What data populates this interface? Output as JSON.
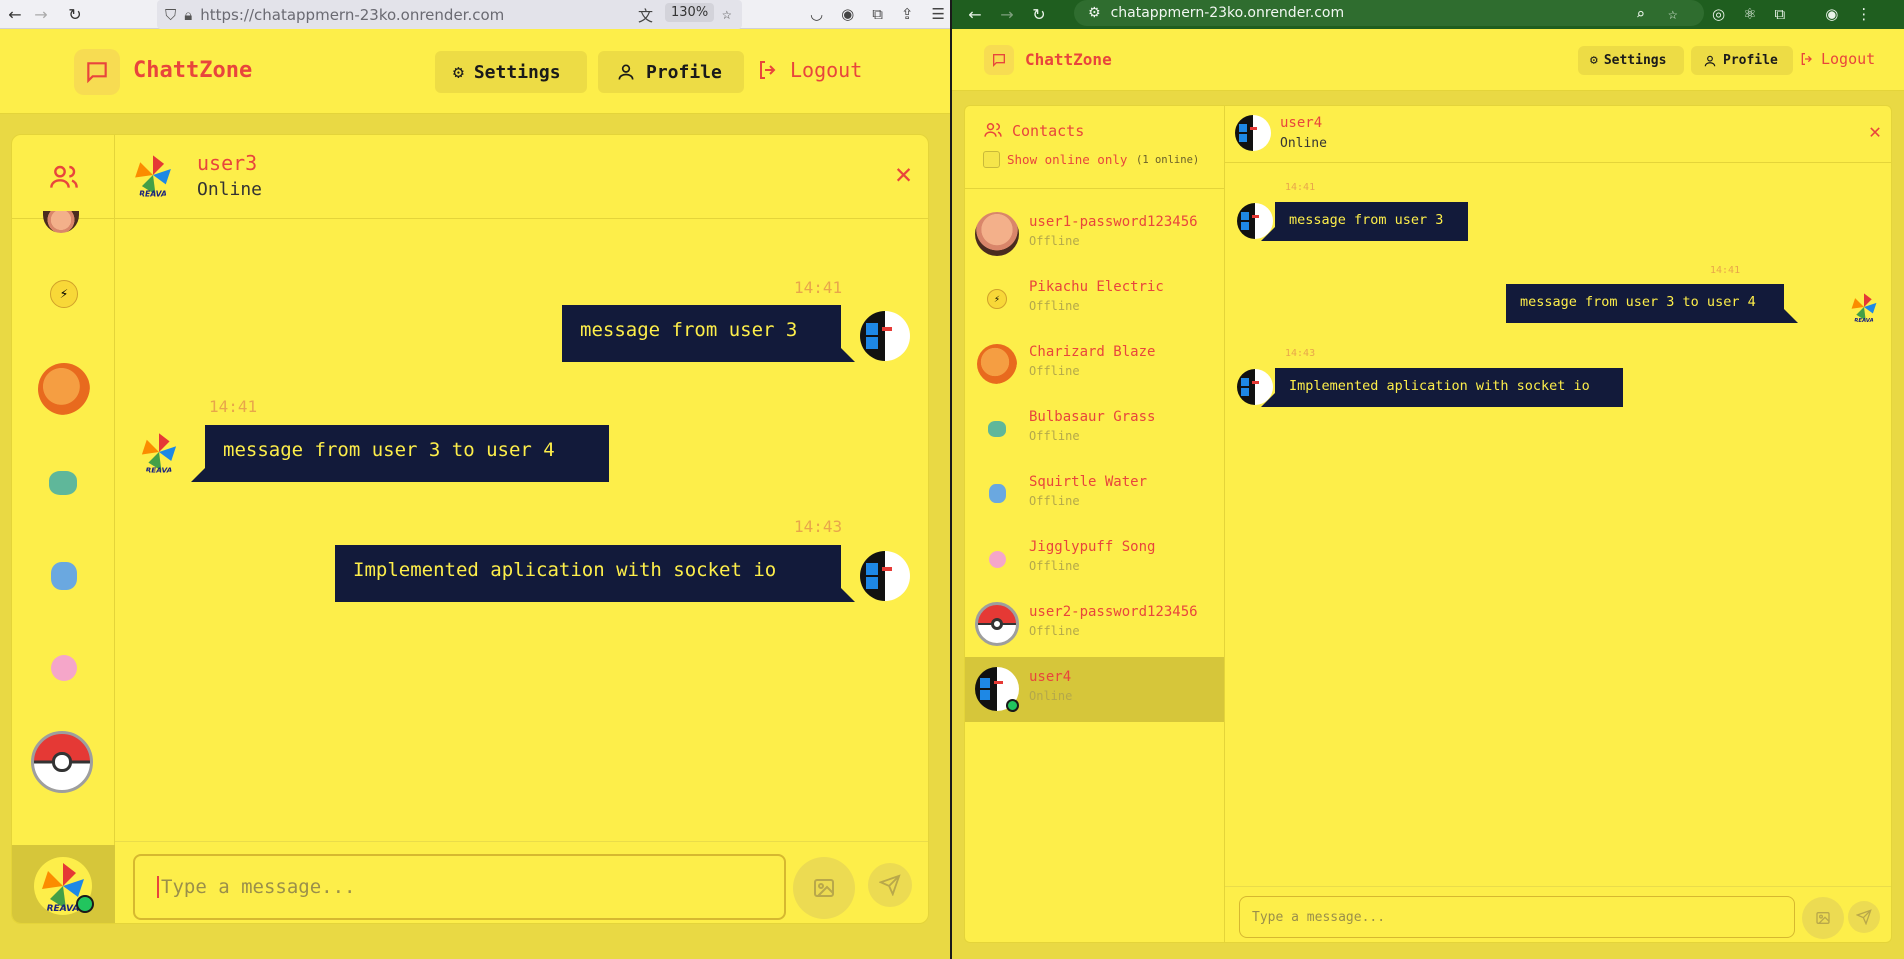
{
  "browser_left": {
    "url": "https://chatappmern-23ko.onrender.com",
    "zoom": "130%"
  },
  "browser_right": {
    "url": "chatappmern-23ko.onrender.com"
  },
  "left_app": {
    "brand": "ChattZone",
    "settings_label": "Settings",
    "profile_label": "Profile",
    "logout_label": "Logout",
    "chat_user": "user3",
    "chat_status": "Online",
    "messages": [
      {
        "time": "14:41",
        "text": "message from user 3",
        "side": "right"
      },
      {
        "time": "14:41",
        "text": "message from user 3 to user 4",
        "side": "left"
      },
      {
        "time": "14:43",
        "text": "Implemented aplication with socket io",
        "side": "right"
      }
    ],
    "input_placeholder": "Type a message..."
  },
  "right_app": {
    "brand": "ChattZone",
    "settings_label": "Settings",
    "profile_label": "Profile",
    "logout_label": "Logout",
    "contacts_title": "Contacts",
    "show_online_label": "Show online only",
    "online_count": "(1 online)",
    "contacts": [
      {
        "name": "user1-password123456",
        "status": "Offline"
      },
      {
        "name": "Pikachu Electric",
        "status": "Offline"
      },
      {
        "name": "Charizard Blaze",
        "status": "Offline"
      },
      {
        "name": "Bulbasaur Grass",
        "status": "Offline"
      },
      {
        "name": "Squirtle Water",
        "status": "Offline"
      },
      {
        "name": "Jigglypuff Song",
        "status": "Offline"
      },
      {
        "name": "user2-password123456",
        "status": "Offline"
      },
      {
        "name": "user4",
        "status": "Online"
      }
    ],
    "chat_user": "user4",
    "chat_status": "Online",
    "messages": [
      {
        "time": "14:41",
        "text": "message from user 3",
        "side": "left"
      },
      {
        "time": "14:41",
        "text": "message from user 3 to user 4",
        "side": "right"
      },
      {
        "time": "14:43",
        "text": "Implemented aplication with socket io",
        "side": "left"
      }
    ],
    "input_placeholder": "Type a message..."
  },
  "colors": {
    "app_bg": "#fdee4a",
    "accent": "#e8453c",
    "bubble": "#121a3a",
    "online": "#22c55e"
  }
}
